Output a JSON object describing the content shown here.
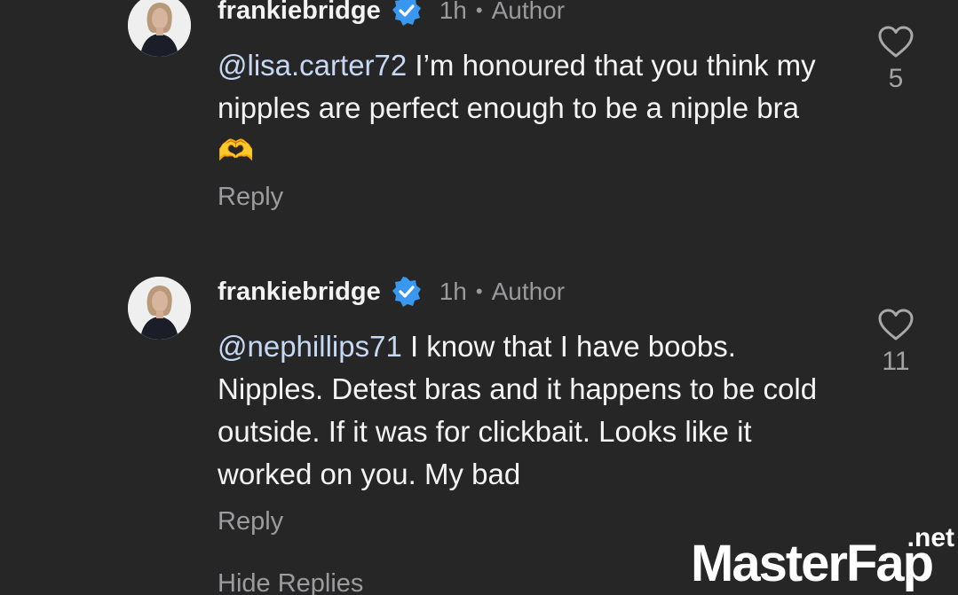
{
  "comments": [
    {
      "username": "frankiebridge",
      "time": "1h",
      "badge": "Author",
      "mention": "@lisa.carter72",
      "text": " I’m honoured that you think my nipples are perfect enough to be a nipple bra ",
      "emoji": "🫶",
      "reply_label": "Reply",
      "likes": "5"
    },
    {
      "username": "frankiebridge",
      "time": "1h",
      "badge": "Author",
      "mention": "@nephillips71",
      "text": " I know that I have boobs. Nipples. Detest bras and it happens to be cold outside. If it was for clickbait. Looks like it worked on you. My bad",
      "reply_label": "Reply",
      "likes": "11"
    }
  ],
  "hide_replies_label": "Hide Replies",
  "watermark": {
    "main": "MasterFap",
    "tld": ".net"
  },
  "colors": {
    "background": "#262627",
    "verified": "#3a97f0",
    "mention": "#c6d8f3",
    "muted": "#9a9a9c"
  },
  "icons": [
    "verified-badge-icon",
    "heart-icon"
  ]
}
